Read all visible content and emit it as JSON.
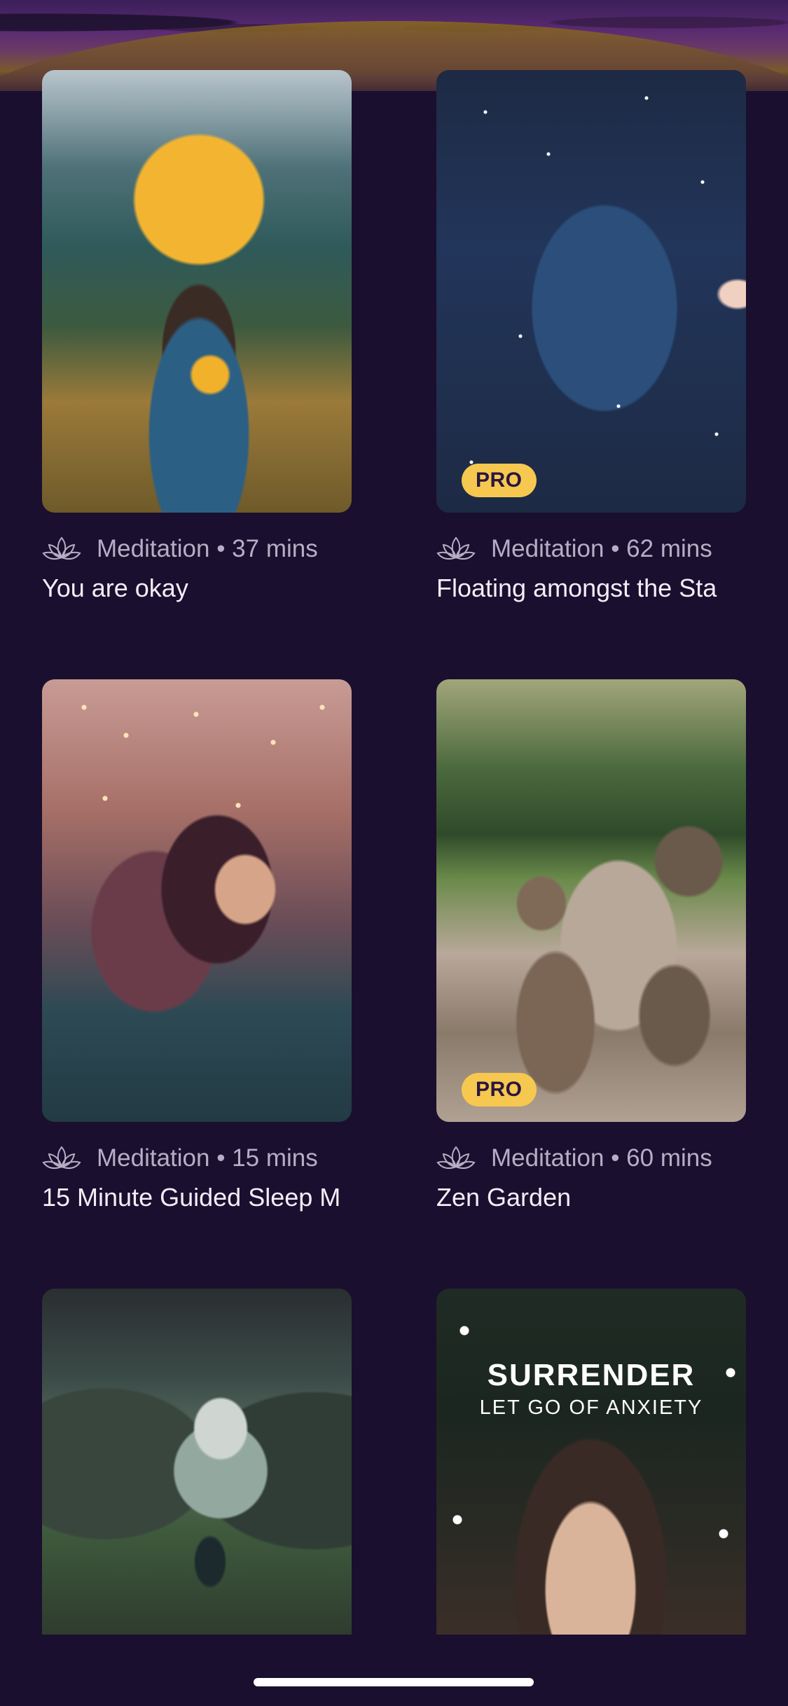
{
  "cards": [
    {
      "meta": "Meditation • 37 mins",
      "title": "You are okay",
      "badge": ""
    },
    {
      "meta": "Meditation • 62 mins",
      "title": "Floating amongst the Sta",
      "badge": "PRO"
    },
    {
      "meta": "Meditation • 15 mins",
      "title": "15 Minute Guided Sleep M",
      "badge": ""
    },
    {
      "meta": "Meditation • 60 mins",
      "title": "Zen Garden",
      "badge": "PRO"
    },
    {
      "meta": "",
      "title": "",
      "badge": ""
    },
    {
      "meta": "",
      "title": "",
      "badge": "",
      "overlay_line1": "SURRENDER",
      "overlay_line2": "LET GO OF ANXIETY"
    }
  ],
  "icons": {
    "lotus": "lotus-icon"
  },
  "colors": {
    "background": "#1a0f2e",
    "pro_badge": "#f6c84f",
    "meta_text": "#b7aec6",
    "title_text": "#f2eef7"
  }
}
